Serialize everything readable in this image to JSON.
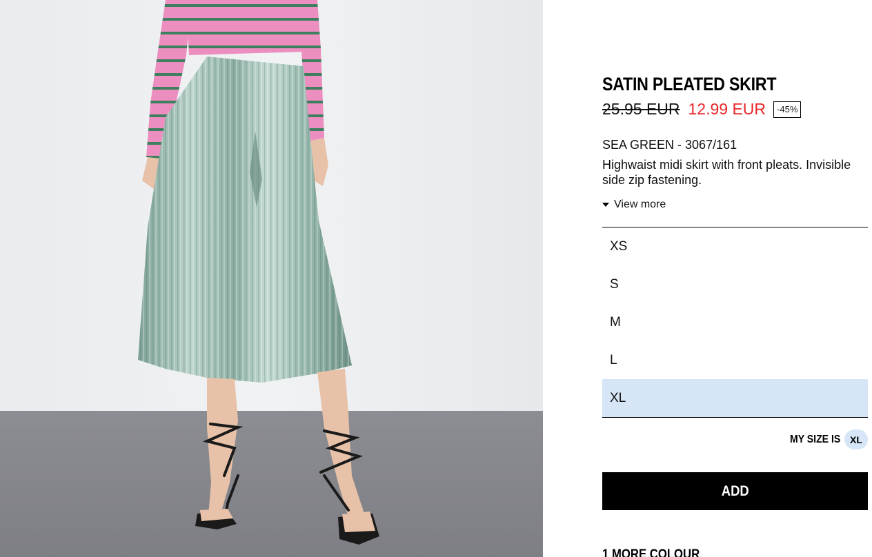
{
  "product": {
    "name": "SATIN PLEATED SKIRT",
    "old_price": "25.95 EUR",
    "new_price": "12.99 EUR",
    "discount": "-45%",
    "color_ref": "SEA GREEN - 3067/161",
    "description": "Highwaist midi skirt with front pleats. Invisible side zip fastening.",
    "view_more_label": "View more"
  },
  "sizes": {
    "items": [
      "XS",
      "S",
      "M",
      "L",
      "XL"
    ],
    "selected": "XL"
  },
  "my_size": {
    "label": "MY SIZE IS",
    "value": "XL"
  },
  "actions": {
    "add_label": "ADD"
  },
  "more_colours_label": "1 MORE COLOUR",
  "colors": {
    "sale_price": "#e8262a",
    "selected_size_bg": "#d6e6f7",
    "button_bg": "#000000",
    "skirt": "#9cbab0",
    "top_stripe_pink": "#ec8fc0",
    "top_stripe_green": "#3d7f5e"
  },
  "image": {
    "icon": "product-photo-skirt-model"
  }
}
